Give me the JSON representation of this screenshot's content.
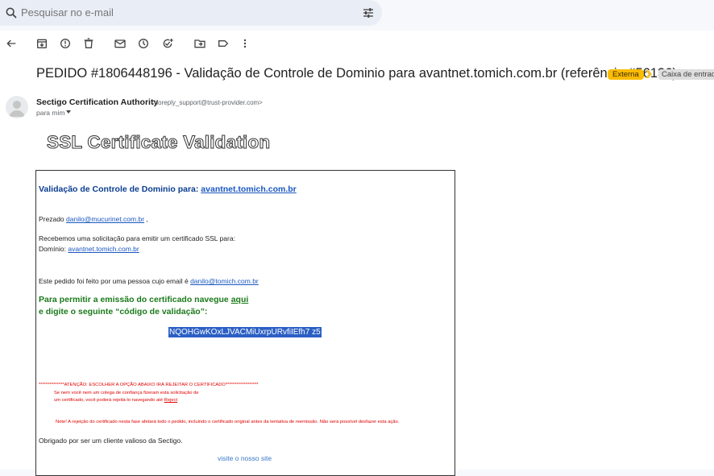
{
  "search": {
    "placeholder": "Pesquisar no e-mail"
  },
  "email": {
    "subject": "PEDIDO #1806448196 - Validação de Controle de Dominio para avantnet.tomich.com.br (referência #56136)",
    "badge_external": "Externa",
    "badge_inbox": "Caixa de entrada ×",
    "sender_name": "Sectigo Certification Authority",
    "sender_email": "<noreply_support@trust-provider.com>",
    "to": "para mim"
  },
  "body": {
    "title": "SSL Certificate Validation",
    "heading_prefix": "Validação de Controle de Dominio para:",
    "heading_domain": "avantnet.tomich.com.br",
    "greeting_prefix": "Prezado",
    "greeting_email": "danilo@mucurinet.com.br",
    "greeting_suffix": ",",
    "request_line": "Recebemos uma solicitação para emitir um certificado SSL para:",
    "domain_label": "Domínio:",
    "domain_link": "avantnet.tomich.com.br",
    "requester_prefix": "Este pedido foi feito por uma pessoa cujo email é",
    "requester_email": "danilo@tomich.com.br",
    "cta_prefix": "Para permitir a emissão do certificado navegue",
    "cta_link": "aqui",
    "cta_line2": "e digite o seguinte “código de validação”:",
    "validation_code": "NQOHGwKOxLJVACMiUxrpURvfiIEfh7 z5",
    "warning": "**************ATENÇÃO: ESCOLHER A OPÇÃO ABAIXO IRÁ REJEITAR O CERTIFICADO******************",
    "reject_line1": "Se nem você nem um colega de confiança fizeram esta solicitação de",
    "reject_line2_prefix": "um certificado, você poderá rejeitá-lo navegando até",
    "reject_link": "Reject",
    "note": "Note! A rejeição do certificado nesta fase afetará todo o pedido, incluindo o certificado original antes da tentativa de reemissão. Não será possível desfazer esta ação.",
    "thanks": "Obrigado por ser um cliente valioso da Sectigo.",
    "visit": "visite o nosso site"
  }
}
